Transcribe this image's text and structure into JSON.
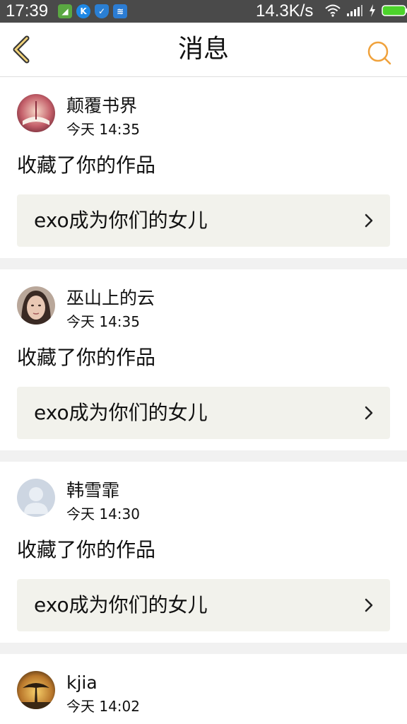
{
  "status_bar": {
    "time": "17:39",
    "net_speed": "14.3K/s",
    "left_icons": [
      "app-icon",
      "k-icon",
      "shield-icon",
      "wifi-share-icon"
    ],
    "right_icons": [
      "wifi-icon",
      "signal-icon",
      "charging-icon",
      "battery-icon"
    ]
  },
  "header": {
    "title": "消息",
    "accent_color": "#f0a23c"
  },
  "messages": [
    {
      "username": "颠覆书界",
      "time": "今天 14:35",
      "action": "收藏了你的作品",
      "work_title": "exo成为你们的女儿",
      "avatar": "book-avatar"
    },
    {
      "username": "巫山上的云",
      "time": "今天 14:35",
      "action": "收藏了你的作品",
      "work_title": "exo成为你们的女儿",
      "avatar": "face-avatar"
    },
    {
      "username": "韩雪霏",
      "time": "今天 14:30",
      "action": "收藏了你的作品",
      "work_title": "exo成为你们的女儿",
      "avatar": "default-avatar"
    },
    {
      "username": "kjia",
      "time": "今天 14:02",
      "action": "",
      "work_title": "",
      "avatar": "tree-avatar"
    }
  ]
}
